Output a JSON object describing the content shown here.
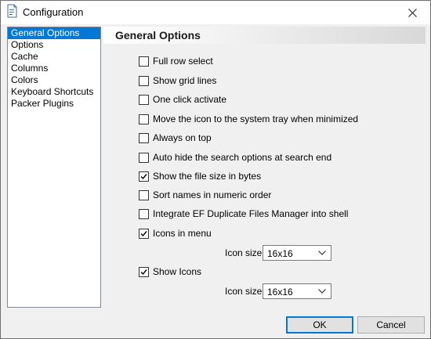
{
  "window": {
    "title": "Configuration"
  },
  "nav": {
    "items": [
      {
        "label": "General Options",
        "selected": true
      },
      {
        "label": "Options"
      },
      {
        "label": "Cache"
      },
      {
        "label": "Columns"
      },
      {
        "label": "Colors"
      },
      {
        "label": "Keyboard Shortcuts"
      },
      {
        "label": "Packer Plugins"
      }
    ]
  },
  "panel": {
    "title": "General Options",
    "options": [
      {
        "label": "Full row select",
        "checked": false
      },
      {
        "label": "Show grid lines",
        "checked": false
      },
      {
        "label": "One click activate",
        "checked": false
      },
      {
        "label": "Move the icon to the system tray when minimized",
        "checked": false
      },
      {
        "label": "Always on top",
        "checked": false
      },
      {
        "label": "Auto hide the search options at search end",
        "checked": false
      },
      {
        "label": "Show the file size in bytes",
        "checked": true
      },
      {
        "label": "Sort names in numeric order",
        "checked": false
      },
      {
        "label": "Integrate EF Duplicate Files Manager into shell",
        "checked": false
      },
      {
        "label": "Icons in menu",
        "checked": true
      },
      {
        "label": "Show Icons",
        "checked": true
      }
    ],
    "menu_icon_size": {
      "label": "Icon size",
      "value": "16x16"
    },
    "show_icon_size": {
      "label": "Icon size",
      "value": "16x16"
    }
  },
  "buttons": {
    "ok": "OK",
    "cancel": "Cancel"
  },
  "colors": {
    "selection": "#0078d7",
    "window_bg": "#f0f0f0"
  }
}
